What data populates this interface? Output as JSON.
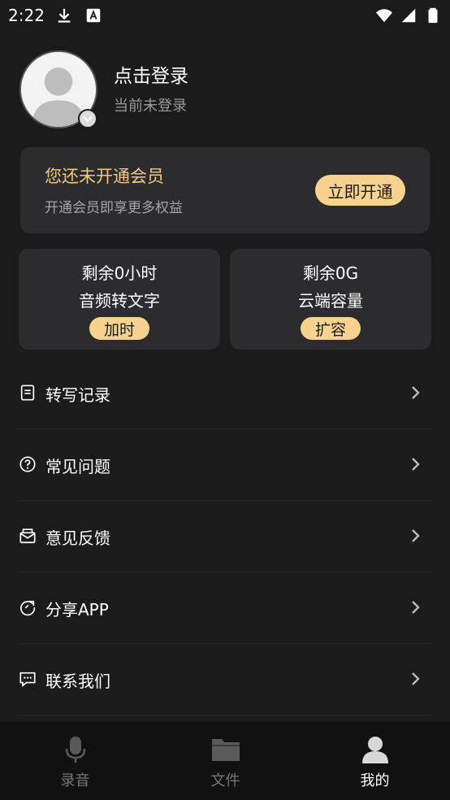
{
  "status_bar": {
    "time": "2:22"
  },
  "profile": {
    "title": "点击登录",
    "subtitle": "当前未登录"
  },
  "vip": {
    "title": "您还未开通会员",
    "subtitle": "开通会员即享更多权益",
    "button": "立即开通"
  },
  "quotas": [
    {
      "line1": "剩余0小时",
      "line2": "音频转文字",
      "button": "加时"
    },
    {
      "line1": "剩余0G",
      "line2": "云端容量",
      "button": "扩容"
    }
  ],
  "menu": {
    "items": [
      {
        "label": "转写记录",
        "icon": "document-icon"
      },
      {
        "label": "常见问题",
        "icon": "help-icon"
      },
      {
        "label": "意见反馈",
        "icon": "feedback-icon"
      },
      {
        "label": "分享APP",
        "icon": "share-icon"
      },
      {
        "label": "联系我们",
        "icon": "chat-icon"
      }
    ]
  },
  "bottom_nav": {
    "items": [
      {
        "label": "录音",
        "icon": "microphone-icon"
      },
      {
        "label": "文件",
        "icon": "folder-icon"
      },
      {
        "label": "我的",
        "icon": "user-icon"
      }
    ],
    "active_index": 2
  },
  "colors": {
    "background": "#1b1b1b",
    "card": "#2c2c2e",
    "accent": "#f8d28f",
    "vip_title": "#f5c77e"
  }
}
